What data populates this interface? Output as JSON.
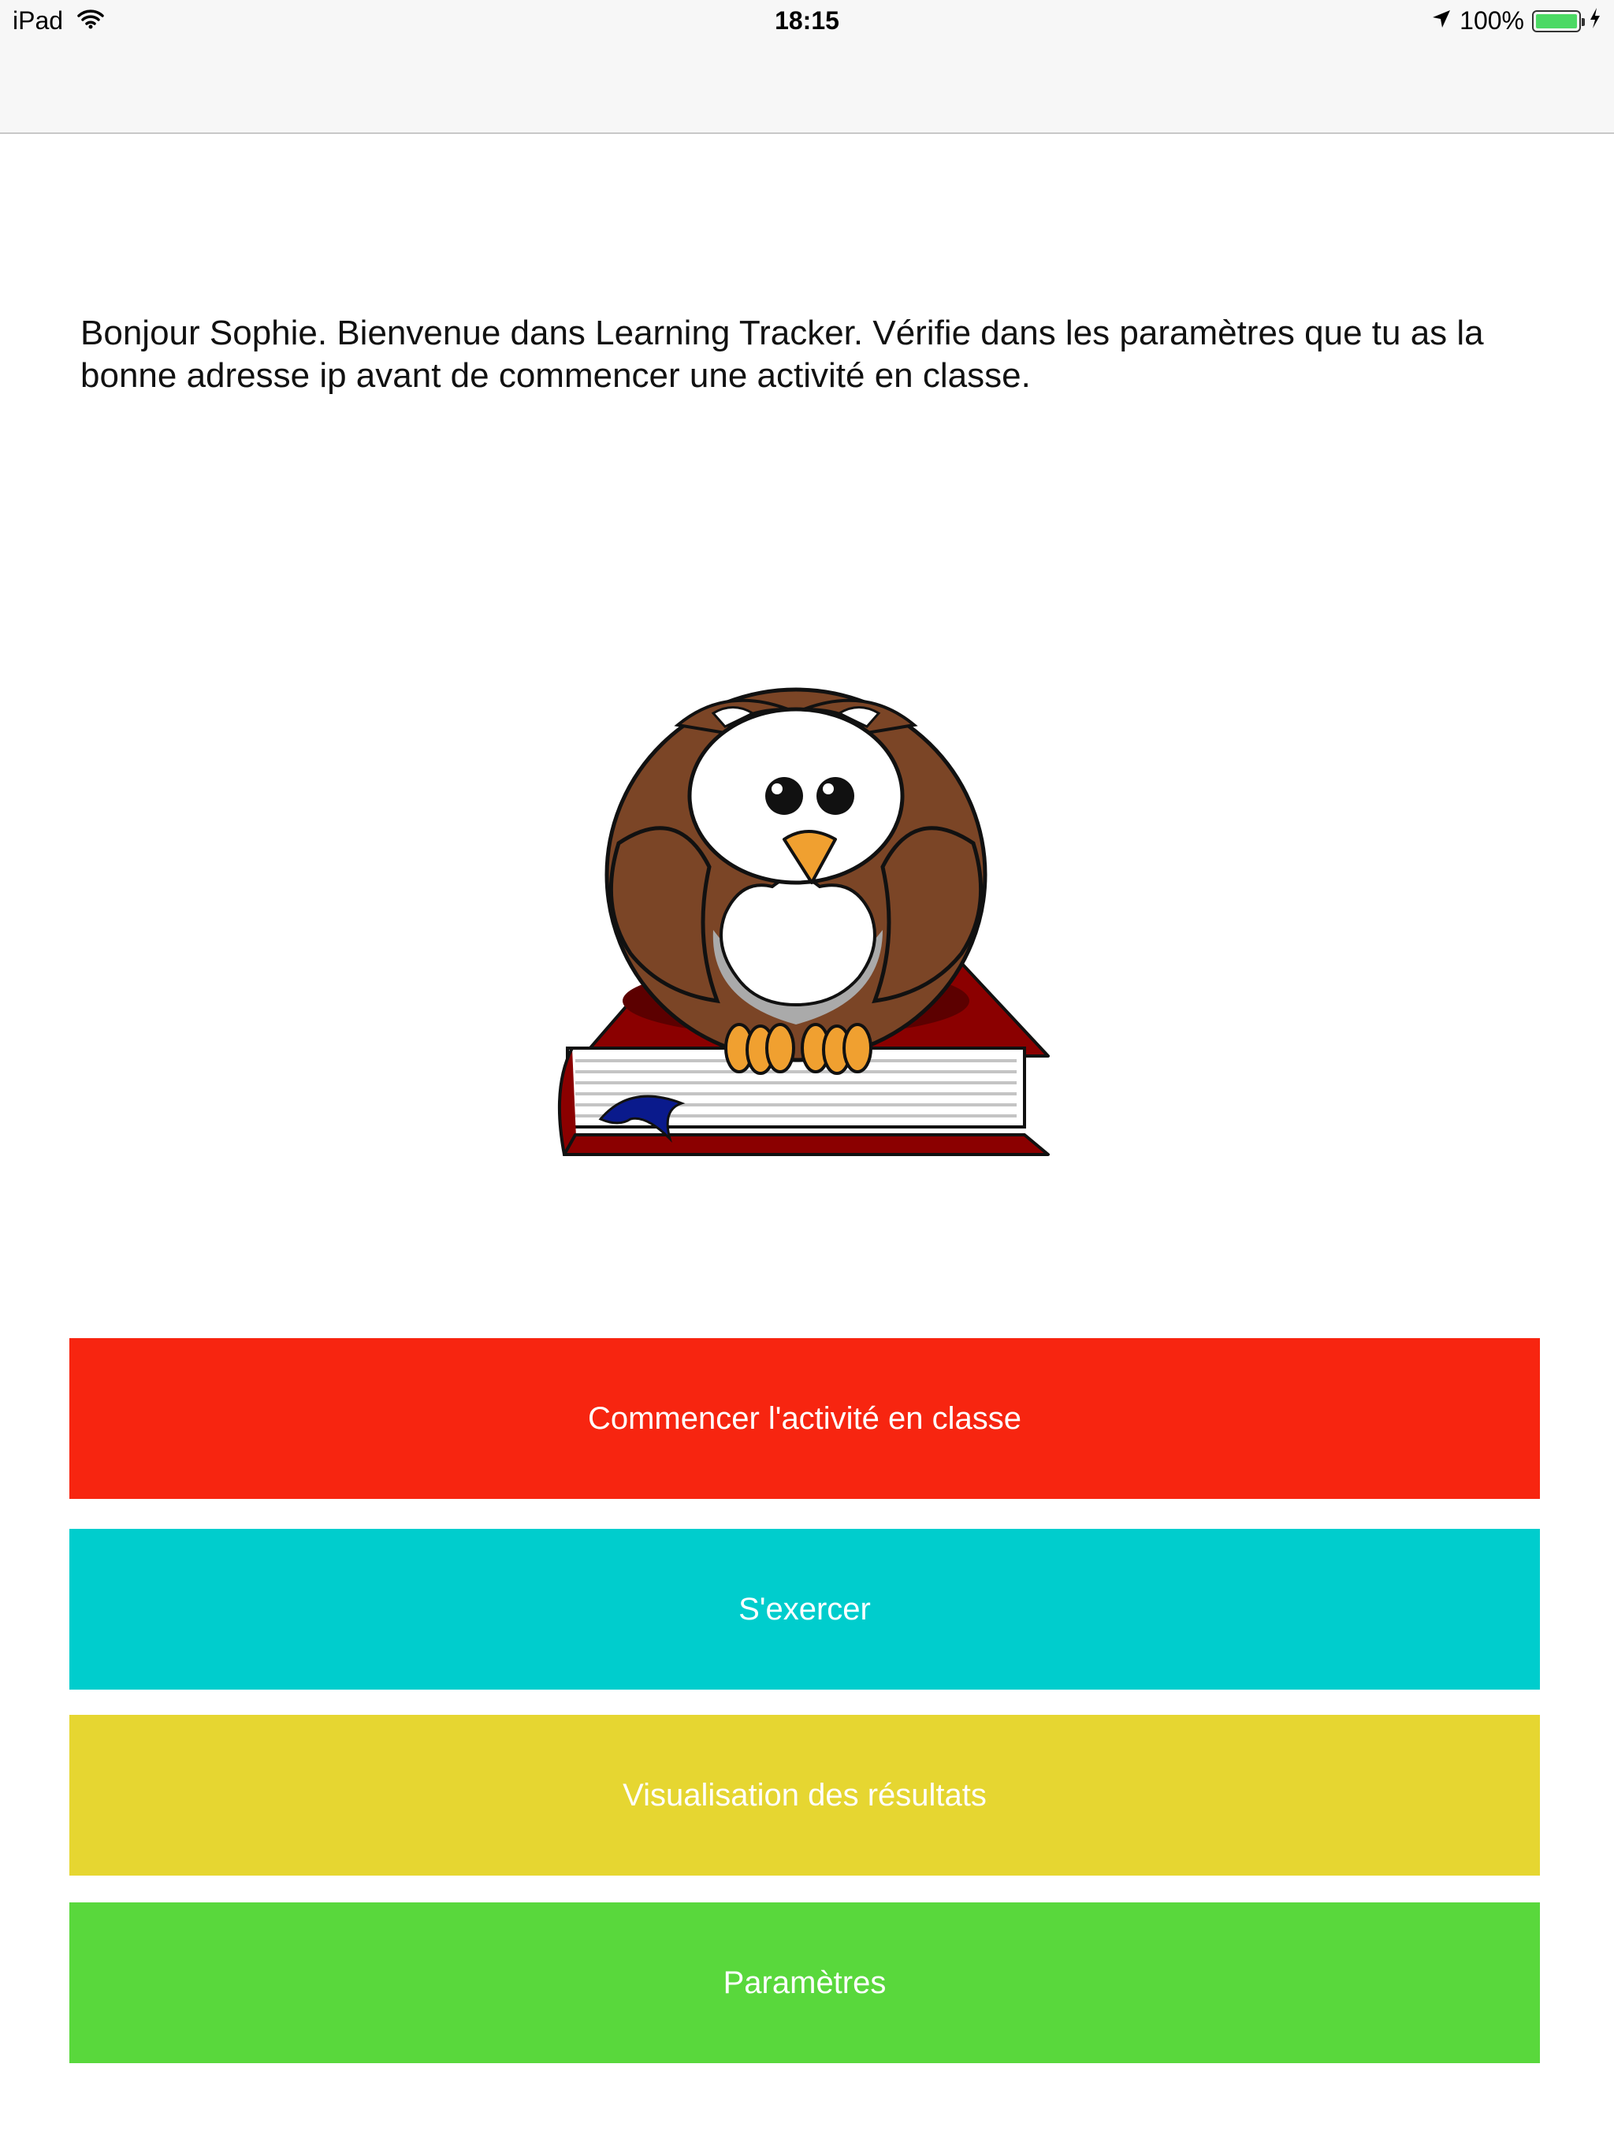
{
  "status_bar": {
    "device": "iPad",
    "time": "18:15",
    "battery_percent": "100%",
    "icons": [
      "wifi-icon",
      "location-arrow-icon",
      "battery-icon",
      "charging-bolt-icon"
    ]
  },
  "welcome_text": "Bonjour Sophie. Bienvenue dans Learning Tracker. Vérifie dans les paramètres que tu as la bonne adresse ip avant de commencer une activité en classe.",
  "illustration": "owl-on-book",
  "buttons": [
    {
      "label": "Commencer l'activité en classe",
      "color": "#f72510"
    },
    {
      "label": "S'exercer",
      "color": "#00cdcd"
    },
    {
      "label": "Visualisation des résultats",
      "color": "#e6d631"
    },
    {
      "label": "Paramètres",
      "color": "#59d83c"
    }
  ]
}
